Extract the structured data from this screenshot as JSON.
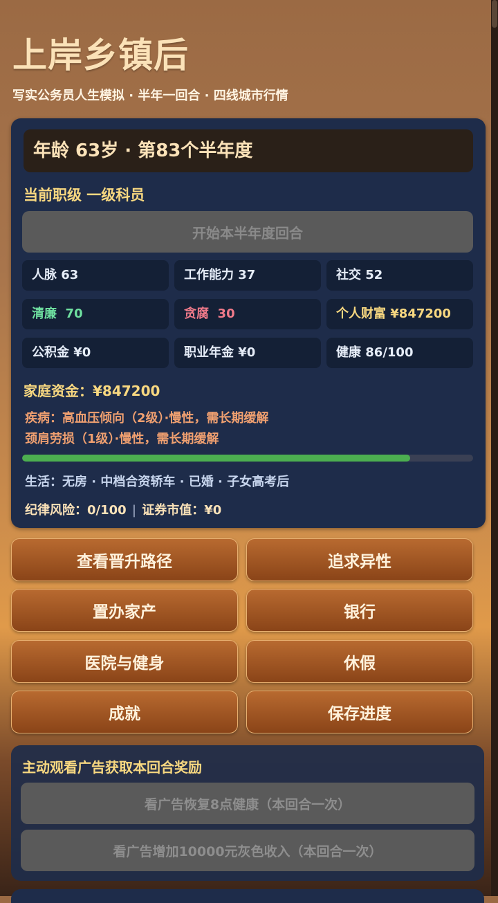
{
  "header": {
    "title": "上岸乡镇后",
    "subtitle": "写实公务员人生模拟 · 半年一回合 · 四线城市行情"
  },
  "status": {
    "age_line": "年龄 63岁 · 第83个半年度",
    "rank": "当前职级 一级科员",
    "start_button": "开始本半年度回合"
  },
  "stats": [
    {
      "label": "人脉 63",
      "color": "#e6edf8"
    },
    {
      "label": "工作能力 37",
      "color": "#e6edf8"
    },
    {
      "label": "社交 52",
      "color": "#e6edf8"
    },
    {
      "label_prefix": "清廉",
      "value": "70",
      "color": "#6fe0a0"
    },
    {
      "label_prefix": "贪腐",
      "value": "30",
      "color": "#f07a8a"
    },
    {
      "label": "个人财富 ¥847200",
      "color": "#f8d880"
    },
    {
      "label": "公积金 ¥0",
      "color": "#e6edf8"
    },
    {
      "label": "职业年金 ¥0",
      "color": "#e6edf8"
    },
    {
      "label": "健康 86/100",
      "color": "#e6edf8"
    }
  ],
  "family_fund": "家庭资金：¥847200",
  "diseases": {
    "line1": "疾病：高血压倾向（2级）·慢性，需长期缓解",
    "line2": "颈肩劳损（1级）·慢性，需长期缓解"
  },
  "health_progress": 0.86,
  "life_line": "生活：无房 · 中档合资轿车 · 已婚 · 子女高考后",
  "risk": {
    "discipline": "纪律风险：0/100",
    "securities": "证券市值：¥0"
  },
  "actions": [
    "查看晋升路径",
    "追求异性",
    "置办家产",
    "银行",
    "医院与健身",
    "休假",
    "成就",
    "保存进度"
  ],
  "ads": {
    "title": "主动观看广告获取本回合奖励",
    "button1": "看广告恢复8点健康（本回合一次）",
    "button2": "看广告增加10000元灰色收入（本回合一次）"
  }
}
